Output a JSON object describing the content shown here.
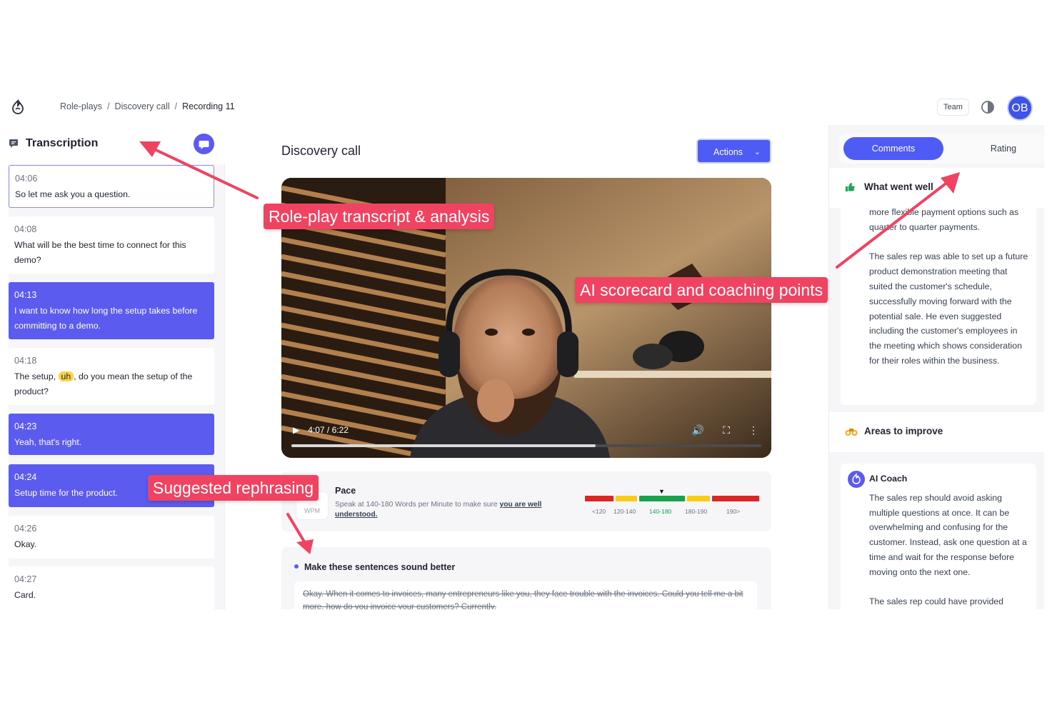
{
  "breadcrumb": [
    "Role-plays",
    "Discovery call",
    "Recording 11"
  ],
  "breadcrumb_sep": "/",
  "topbar": {
    "team_label": "Team",
    "avatar_initials": "OB"
  },
  "transcription": {
    "title": "Transcription",
    "items": [
      {
        "time": "04:06",
        "text": "So let me ask you a question.",
        "state": "selected"
      },
      {
        "time": "04:08",
        "text": "What will be the best time to connect for this demo?",
        "state": "normal"
      },
      {
        "time": "04:13",
        "text": "I want to know how long the setup takes before committing to a demo.",
        "state": "highlighted"
      },
      {
        "time": "04:18",
        "text_before": "The setup, ",
        "filler": "uh",
        "text_after": ", do you mean the setup of the product?",
        "state": "normal"
      },
      {
        "time": "04:23",
        "text": "Yeah, that's right.",
        "state": "highlighted"
      },
      {
        "time": "04:24",
        "text": "Setup time for the product.",
        "state": "highlighted"
      },
      {
        "time": "04:26",
        "text": "Okay.",
        "state": "normal"
      },
      {
        "time": "04:27",
        "text": "Card.",
        "state": "normal"
      }
    ]
  },
  "main": {
    "title": "Discovery call",
    "actions_label": "Actions",
    "video": {
      "time_display": "4:07 / 6:22",
      "progress": 0.6477
    },
    "pace": {
      "badge": "WPM",
      "title": "Pace",
      "description": "Speak at 140-180 Words per Minute to make sure ",
      "description_link": "you are well understood.",
      "ranges": [
        "<120",
        "120-140",
        "140-180",
        "180-190",
        "190>"
      ],
      "colors": [
        "#dc2626",
        "#facc15",
        "#16a34a",
        "#facc15",
        "#dc2626"
      ],
      "current_range": "140-180"
    },
    "rephrase": {
      "title": "Make these sentences sound better",
      "original": "Okay. When it comes to invoices, many entrepreneurs like you, they face trouble with the invoices. Could you tell me a bit more, how do you invoice your customers? Currently,"
    }
  },
  "feedback": {
    "tabs": [
      "Comments",
      "Rating"
    ],
    "active_tab": "Comments",
    "went_well": {
      "title": "What went well",
      "paragraphs": [
        "more flexible payment options such as quarter to quarter payments.",
        "The sales rep was able to set up a future product demonstration meeting that suited the customer's schedule, successfully moving forward with the potential sale. He even suggested including the customer's employees in the meeting which shows consideration for their roles within the business."
      ]
    },
    "improve": {
      "title": "Areas to improve",
      "coach_name": "AI Coach",
      "paragraphs": [
        "The sales rep should avoid asking multiple questions at once. It can be overwhelming and confusing for the customer. Instead, ask one question at a time and wait for the response before moving onto the next one.",
        "The sales rep could have provided"
      ]
    }
  },
  "annotations": {
    "transcript": "Role-play transcript & analysis",
    "scorecard": "AI scorecard and coaching points",
    "rephrasing": "Suggested rephrasing"
  },
  "colors": {
    "accent": "#5b5bf0",
    "annotation": "#ef4361"
  }
}
